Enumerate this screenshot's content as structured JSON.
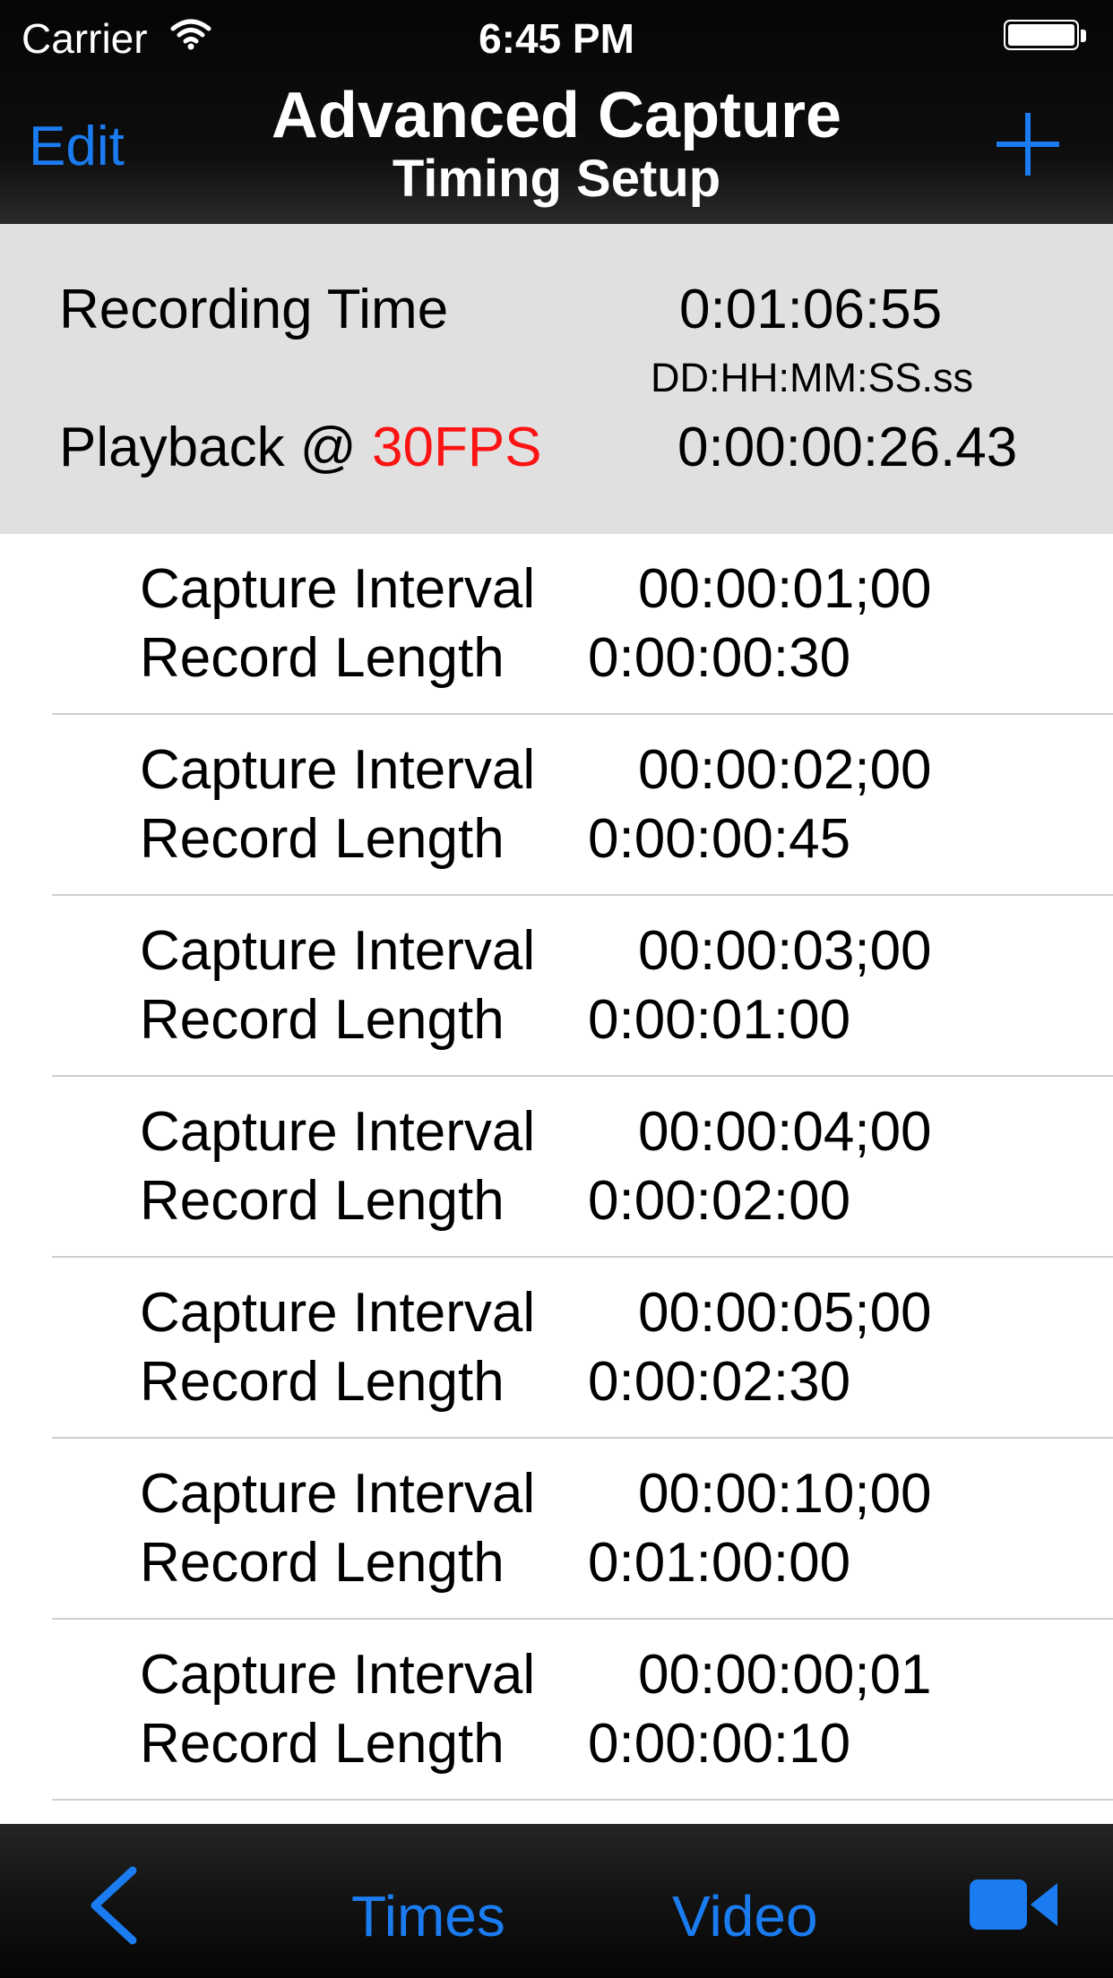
{
  "status_bar": {
    "carrier": "Carrier",
    "time": "6:45 PM"
  },
  "nav": {
    "edit_label": "Edit",
    "title": "Advanced Capture",
    "subtitle": "Timing Setup"
  },
  "summary": {
    "recording_time_label": "Recording Time",
    "recording_time_value": "0:01:06:55",
    "format_hint": "DD:HH:MM:SS.ss",
    "playback_label": "Playback @",
    "playback_fps": "30FPS",
    "playback_value": "0:00:00:26.43"
  },
  "rows": [
    {
      "ci_label": "Capture Interval",
      "ci_value": "00:00:01;00",
      "rl_label": "Record Length",
      "rl_value": "0:00:00:30"
    },
    {
      "ci_label": "Capture Interval",
      "ci_value": "00:00:02;00",
      "rl_label": "Record Length",
      "rl_value": "0:00:00:45"
    },
    {
      "ci_label": "Capture Interval",
      "ci_value": "00:00:03;00",
      "rl_label": "Record Length",
      "rl_value": "0:00:01:00"
    },
    {
      "ci_label": "Capture Interval",
      "ci_value": "00:00:04;00",
      "rl_label": "Record Length",
      "rl_value": "0:00:02:00"
    },
    {
      "ci_label": "Capture Interval",
      "ci_value": "00:00:05;00",
      "rl_label": "Record Length",
      "rl_value": "0:00:02:30"
    },
    {
      "ci_label": "Capture Interval",
      "ci_value": "00:00:10;00",
      "rl_label": "Record Length",
      "rl_value": "0:01:00:00"
    },
    {
      "ci_label": "Capture Interval",
      "ci_value": "00:00:00;01",
      "rl_label": "Record Length",
      "rl_value": "0:00:00:10"
    }
  ],
  "tabbar": {
    "back_icon": "chevron-left-icon",
    "times_label": "Times",
    "video_label": "Video",
    "camera_icon": "video-camera-icon"
  },
  "colors": {
    "accent": "#1a7cf0",
    "fps_red": "#fc1414",
    "summary_bg": "#e0e0e0"
  }
}
